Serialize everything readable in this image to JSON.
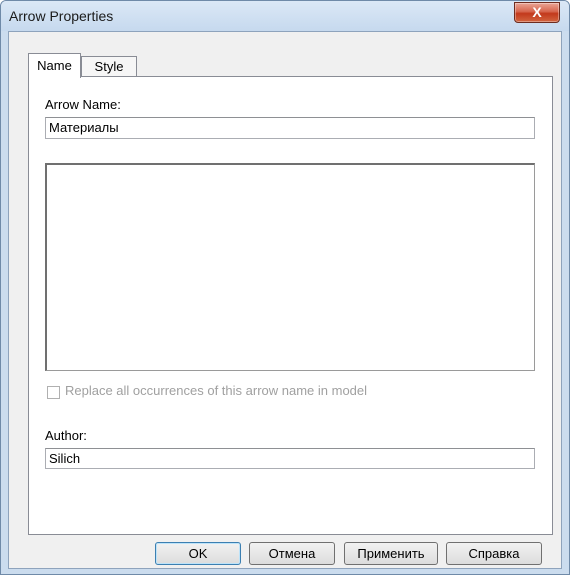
{
  "window": {
    "title": "Arrow Properties",
    "close_glyph": "X"
  },
  "tabs": [
    {
      "label": "Name"
    },
    {
      "label": "Style"
    }
  ],
  "form": {
    "arrow_name_label": "Arrow Name:",
    "arrow_name_value": "Материалы",
    "description_value": "",
    "replace_checkbox_label": "Replace all occurrences of this arrow name in model",
    "author_label": "Author:",
    "author_value": "Silich"
  },
  "buttons": {
    "ok": "OK",
    "cancel": "Отмена",
    "apply": "Применить",
    "help": "Справка"
  }
}
